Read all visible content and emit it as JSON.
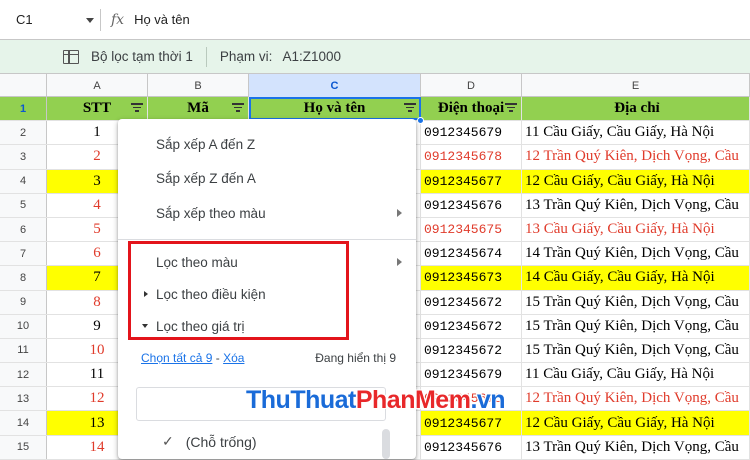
{
  "formula_bar": {
    "cell_ref": "C1",
    "fx_label": "fx",
    "value": "Họ và tên"
  },
  "filter_bar": {
    "filter_name": "Bộ lọc tạm thời 1",
    "range_label": "Phạm vi:",
    "range_value": "A1:Z1000"
  },
  "columns": [
    "A",
    "B",
    "C",
    "D",
    "E"
  ],
  "header_row": {
    "number": "1",
    "stt": "STT",
    "ma": "Mã",
    "name": "Họ và tên",
    "phone": "Điện thoại",
    "address": "Địa chỉ"
  },
  "rows": [
    {
      "n": "2",
      "stt": "1",
      "phone": "0912345679",
      "address": "11 Cầu Giấy, Cầu Giấy, Hà Nội",
      "style": "normal"
    },
    {
      "n": "3",
      "stt": "2",
      "phone": "0912345678",
      "address": "12 Trần Quý Kiên, Dịch Vọng, Cầu",
      "style": "red"
    },
    {
      "n": "4",
      "stt": "3",
      "phone": "0912345677",
      "address": "12 Cầu Giấy, Cầu Giấy, Hà Nội",
      "style": "yellow"
    },
    {
      "n": "5",
      "stt": "4",
      "phone": "0912345676",
      "address": "13 Trần Quý Kiên, Dịch Vọng, Cầu",
      "style": "redstt"
    },
    {
      "n": "6",
      "stt": "5",
      "phone": "0912345675",
      "address": "13 Cầu Giấy, Cầu Giấy, Hà Nội",
      "style": "redrow"
    },
    {
      "n": "7",
      "stt": "6",
      "phone": "0912345674",
      "address": "14 Trần Quý Kiên, Dịch Vọng, Cầu",
      "style": "redstt"
    },
    {
      "n": "8",
      "stt": "7",
      "phone": "0912345673",
      "address": "14 Cầu Giấy, Cầu Giấy, Hà Nội",
      "style": "yellow"
    },
    {
      "n": "9",
      "stt": "8",
      "phone": "0912345672",
      "address": "15 Trần Quý Kiên, Dịch Vọng, Cầu",
      "style": "redstt"
    },
    {
      "n": "10",
      "stt": "9",
      "phone": "0912345672",
      "address": "15 Trần Quý Kiên, Dịch Vọng, Cầu",
      "style": "normal"
    },
    {
      "n": "11",
      "stt": "10",
      "phone": "0912345672",
      "address": "15 Trần Quý Kiên, Dịch Vọng, Cầu",
      "style": "redstt"
    },
    {
      "n": "12",
      "stt": "11",
      "phone": "0912345679",
      "address": "11 Cầu Giấy, Cầu Giấy, Hà Nội",
      "style": "normal"
    },
    {
      "n": "13",
      "stt": "12",
      "phone": "0912345678",
      "address": "12 Trần Quý Kiên, Dịch Vọng, Cầu",
      "style": "red"
    },
    {
      "n": "14",
      "stt": "13",
      "phone": "0912345677",
      "address": "12 Cầu Giấy, Cầu Giấy, Hà Nội",
      "style": "yellow"
    },
    {
      "n": "15",
      "stt": "14",
      "phone": "0912345676",
      "address": "13 Trần Quý Kiên, Dịch Vọng, Cầu",
      "style": "redstt"
    }
  ],
  "menu": {
    "sort_az": "Sắp xếp A đến Z",
    "sort_za": "Sắp xếp Z đến A",
    "sort_color": "Sắp xếp theo màu",
    "filter_color": "Lọc theo màu",
    "filter_condition": "Lọc theo điều kiện",
    "filter_values": "Lọc theo giá trị",
    "select_all": "Chọn tất cả 9",
    "dash": "-",
    "clear": "Xóa",
    "showing": "Đang hiển thị 9",
    "blank": "(Chỗ trống)"
  },
  "watermark": {
    "part1": "ThuThuat",
    "part2": "PhanMem",
    "part3": ".vn"
  },
  "colors": {
    "header_green": "#92d050",
    "highlight_yellow": "#ffff00",
    "red_text": "#e03b2b",
    "selection_blue": "#1a73e8",
    "callout_red": "#e3141b"
  }
}
